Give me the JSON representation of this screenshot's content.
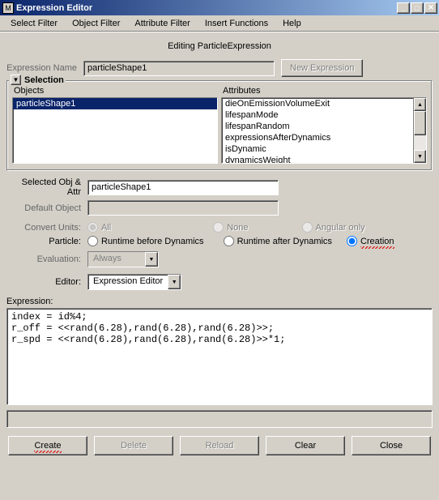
{
  "window": {
    "title": "Expression Editor",
    "icon": "M"
  },
  "menu": {
    "select_filter": "Select Filter",
    "object_filter": "Object Filter",
    "attribute_filter": "Attribute Filter",
    "insert_functions": "Insert Functions",
    "help": "Help"
  },
  "header": {
    "editing": "Editing ParticleExpression",
    "expr_name_label": "Expression Name",
    "expr_name_value": "particleShape1",
    "new_expression": "New Expression"
  },
  "selection": {
    "legend": "Selection",
    "objects_label": "Objects",
    "attributes_label": "Attributes",
    "objects": [
      "particleShape1"
    ],
    "attributes": [
      "dieOnEmissionVolumeExit",
      "lifespanMode",
      "lifespanRandom",
      "expressionsAfterDynamics",
      "isDynamic",
      "dynamicsWeight"
    ]
  },
  "fields": {
    "selected_label": "Selected Obj & Attr",
    "selected_value": "particleShape1",
    "default_object_label": "Default Object",
    "default_object_value": "",
    "convert_units_label": "Convert Units:",
    "convert_all": "All",
    "convert_none": "None",
    "convert_angular": "Angular only",
    "particle_label": "Particle:",
    "runtime_before": "Runtime before Dynamics",
    "runtime_after": "Runtime after Dynamics",
    "creation": "Creation",
    "evaluation_label": "Evaluation:",
    "evaluation_value": "Always",
    "editor_label": "Editor:",
    "editor_value": "Expression Editor",
    "expression_label": "Expression:",
    "expression_body": "index = id%4;\nr_off = <<rand(6.28),rand(6.28),rand(6.28)>>;\nr_spd = <<rand(6.28),rand(6.28),rand(6.28)>>*1;"
  },
  "buttons": {
    "create": "Create",
    "delete": "Delete",
    "reload": "Reload",
    "clear": "Clear",
    "close": "Close"
  }
}
